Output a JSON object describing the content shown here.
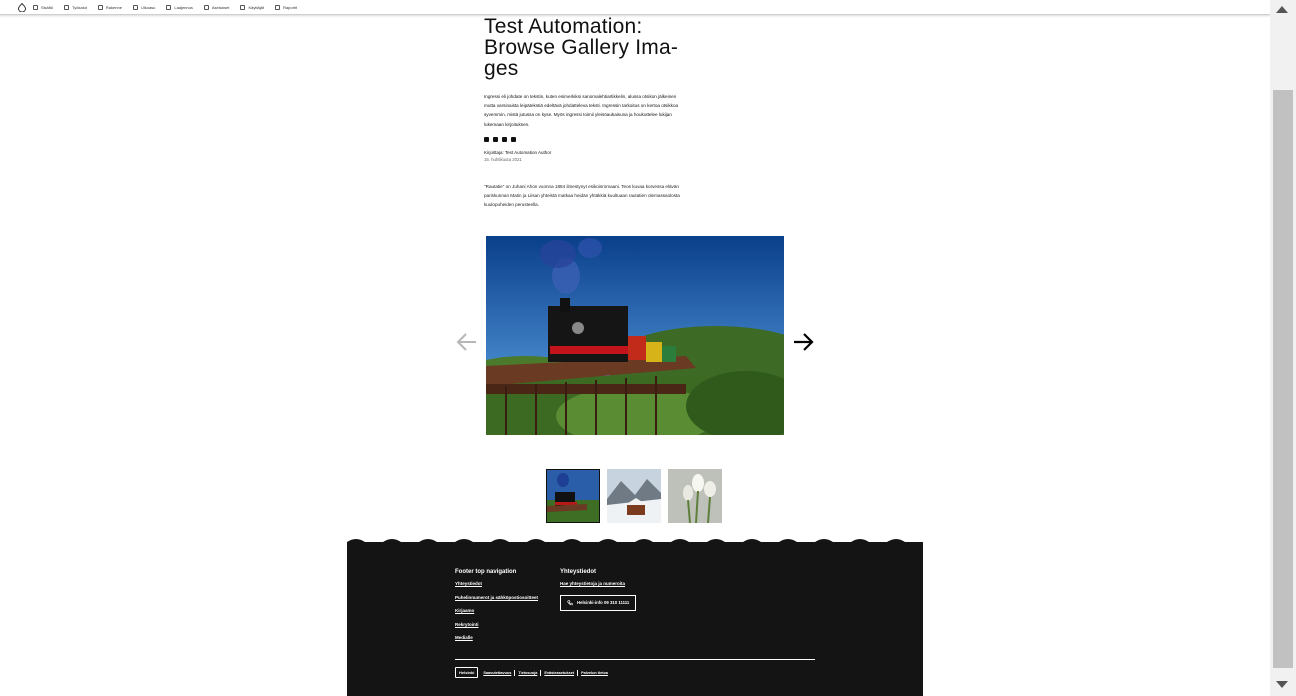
{
  "toolbar": {
    "items": [
      {
        "label": "Sisältö",
        "icon": "content-icon"
      },
      {
        "label": "Työkalut",
        "icon": "tools-icon"
      },
      {
        "label": "Rakenne",
        "icon": "structure-icon"
      },
      {
        "label": "Ulkoasu",
        "icon": "appearance-icon"
      },
      {
        "label": "Laajennus",
        "icon": "extend-icon"
      },
      {
        "label": "Asetukset",
        "icon": "settings-icon"
      },
      {
        "label": "Käyttäjät",
        "icon": "people-icon"
      },
      {
        "label": "Raportit",
        "icon": "reports-icon"
      }
    ]
  },
  "article": {
    "title": "Test Automation: Browse Gallery Ima-ges",
    "ingress": "Ingressi eli johdate on tekstin, kuten esimerkiksi sanomalehtiartikkelin, alussa otsikon jälkeinen mutta varsinaista leipätekstiä edeltävä johdatteleva teksti. Ingressin tarkoitus on kertoa otsikkoa syvemmin, mistä jutussa on kyse. Myös ingressi toimii yleisöaukaisuna ja houkuttelee lukijan lukemaan kirjoituksen.",
    "author": "Kirjoittaja: Test Automation Author",
    "date": "15. huhtikuuta 2021",
    "body": "\"Rautatie\" on Juhani Ahon vuonna 1884 ilmestynyt esikoisromaani. Teos kuvaa korvessa elävän pariskunnan Matin ja Liisan yhteistä matkaa heidän yhtäkkiä kuultuaan rautatien olemassaolosta kuulopuheiden perusteella."
  },
  "gallery": {
    "prev_label": "Previous image",
    "next_label": "Next image",
    "thumbnails": [
      "Steam train on bridge",
      "Snowy mountain village",
      "White tulips"
    ]
  },
  "footer": {
    "col1_heading": "Footer top navigation",
    "col1_links": [
      "Yhteystiedot",
      "Puhelinnumerot ja sähköpostiosoitteet",
      "Kirjaamo",
      "Rekrytointi",
      "Medialle"
    ],
    "col2_heading": "Yhteystiedot",
    "col2_link": "Hae yhteystietoja ja numeroita",
    "phone_button": "Helsinki-info 09 310 11111",
    "logo": "Helsinki",
    "bottom_links": [
      "Saavutettavuus",
      "Tietosuoja",
      "Evästeasetukset",
      "Palvelun tietoa"
    ]
  },
  "colors": {
    "footer_bg": "#141414",
    "text": "#111111"
  }
}
